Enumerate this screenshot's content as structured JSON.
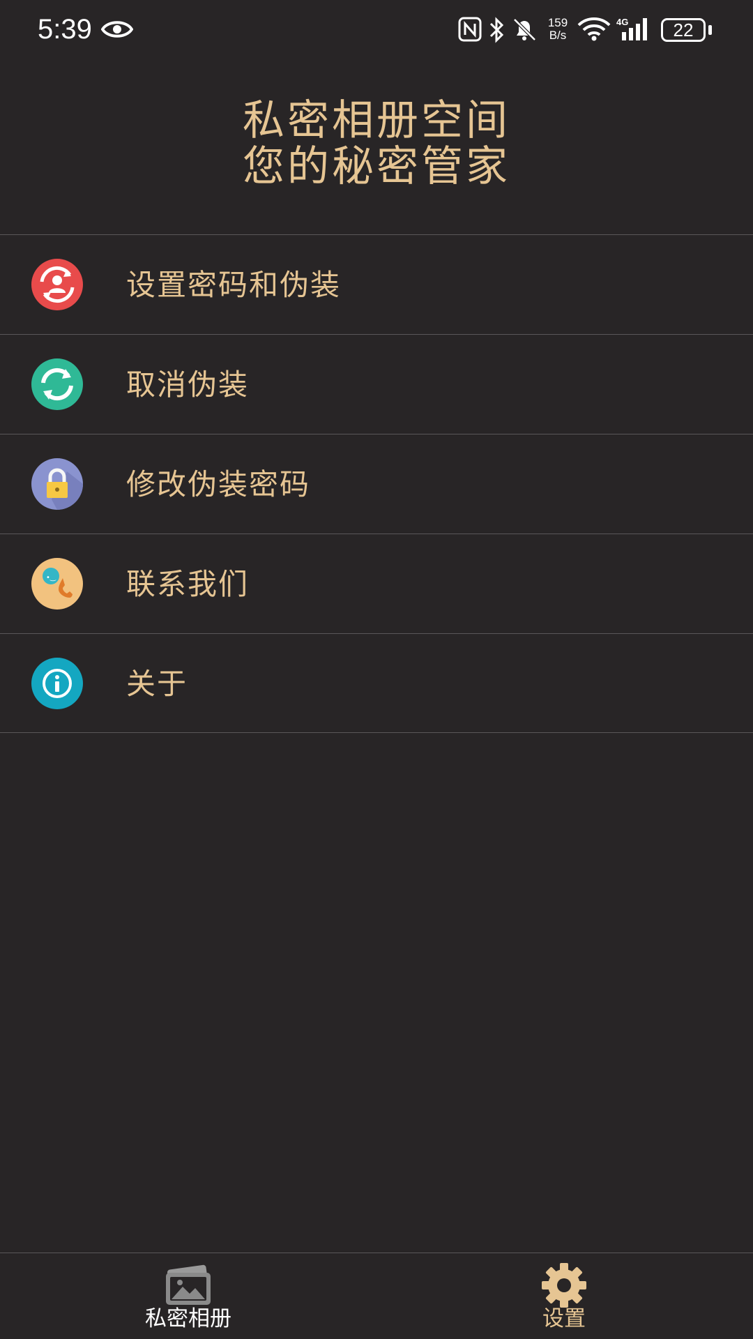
{
  "status_bar": {
    "time": "5:39",
    "net_speed_value": "159",
    "net_speed_unit": "B/s",
    "battery": "22"
  },
  "header": {
    "line1": "私密相册空间",
    "line2": "您的秘密管家"
  },
  "menu": {
    "items": [
      {
        "label": "设置密码和伪装",
        "icon": "user-sync-icon",
        "color": "#e84b4b"
      },
      {
        "label": "取消伪装",
        "icon": "refresh-icon",
        "color": "#2fb996"
      },
      {
        "label": "修改伪装密码",
        "icon": "lock-icon",
        "color": "#8a93cf"
      },
      {
        "label": "联系我们",
        "icon": "phone-chat-icon",
        "color": "#f2c27f"
      },
      {
        "label": "关于",
        "icon": "info-icon",
        "color": "#14a7c1"
      }
    ]
  },
  "bottom_nav": {
    "album_label": "私密相册",
    "settings_label": "设置",
    "active": "设置"
  },
  "colors": {
    "background": "#282526",
    "accent": "#e6c593",
    "divider": "#5a5759"
  }
}
